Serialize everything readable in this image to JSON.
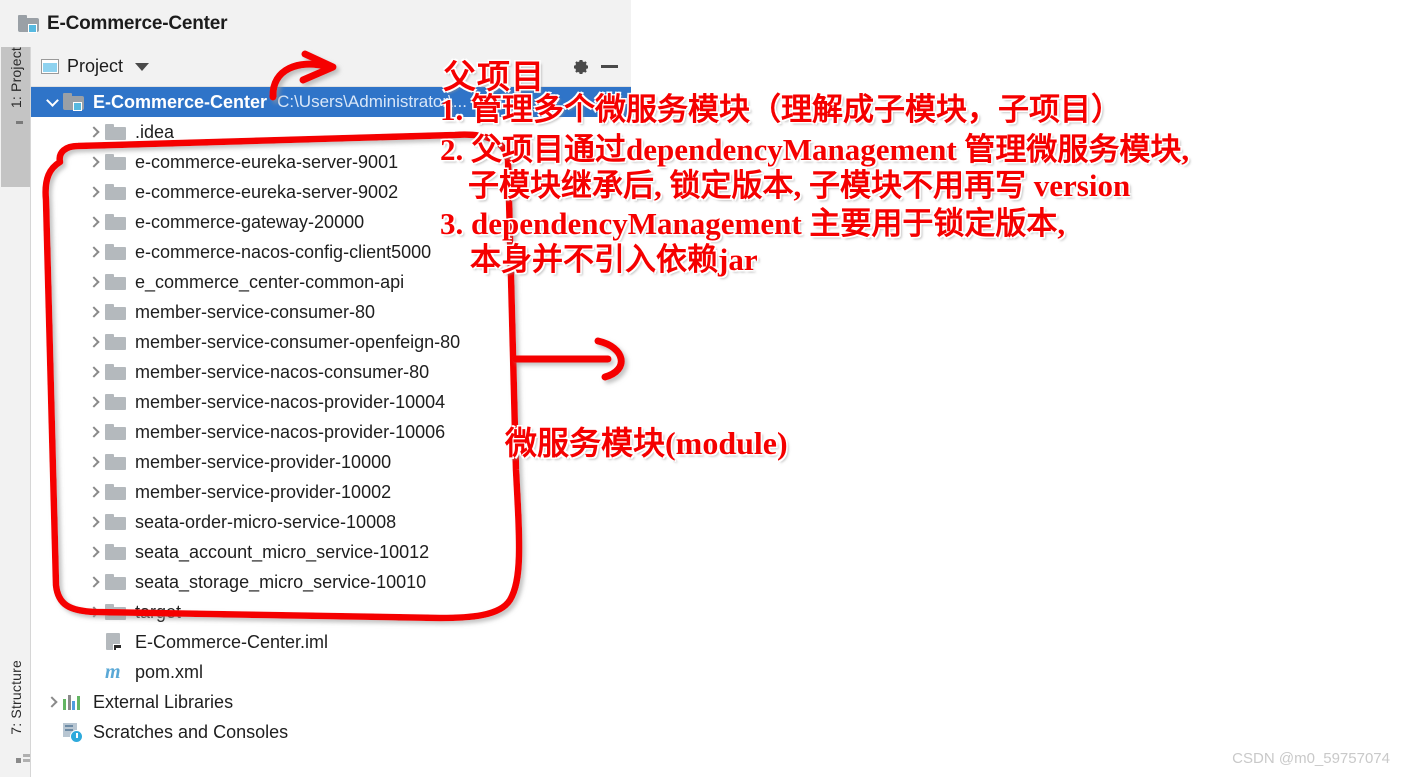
{
  "window": {
    "title": "E-Commerce-Center",
    "title_icon": "project-folder-icon"
  },
  "toolstrip": {
    "tabs": [
      {
        "label": "1: Project",
        "icon": "folder-icon",
        "active": true
      },
      {
        "label": "7: Structure",
        "icon": "structure-icon",
        "active": false
      }
    ]
  },
  "tool_window": {
    "title": "Project",
    "dropdown_icon": "chevron-down-icon",
    "view_icon": "project-view-icon",
    "settings_icon": "gear-icon",
    "hide_icon": "minimize-icon"
  },
  "tree": [
    {
      "label": "E-Commerce-Center",
      "path": "C:\\Users\\Administrator\\...",
      "icon": "project-folder-icon",
      "expanded": true,
      "selected": true,
      "depth": 0,
      "bold": true
    },
    {
      "label": ".idea",
      "icon": "folder-icon",
      "expandable": true,
      "depth": 1
    },
    {
      "label": "e-commerce-eureka-server-9001",
      "icon": "folder-icon",
      "expandable": true,
      "depth": 1
    },
    {
      "label": "e-commerce-eureka-server-9002",
      "icon": "folder-icon",
      "expandable": true,
      "depth": 1
    },
    {
      "label": "e-commerce-gateway-20000",
      "icon": "folder-icon",
      "expandable": true,
      "depth": 1
    },
    {
      "label": "e-commerce-nacos-config-client5000",
      "icon": "folder-icon",
      "expandable": true,
      "depth": 1
    },
    {
      "label": "e_commerce_center-common-api",
      "icon": "folder-icon",
      "expandable": true,
      "depth": 1
    },
    {
      "label": "member-service-consumer-80",
      "icon": "folder-icon",
      "expandable": true,
      "depth": 1
    },
    {
      "label": "member-service-consumer-openfeign-80",
      "icon": "folder-icon",
      "expandable": true,
      "depth": 1
    },
    {
      "label": "member-service-nacos-consumer-80",
      "icon": "folder-icon",
      "expandable": true,
      "depth": 1
    },
    {
      "label": "member-service-nacos-provider-10004",
      "icon": "folder-icon",
      "expandable": true,
      "depth": 1
    },
    {
      "label": "member-service-nacos-provider-10006",
      "icon": "folder-icon",
      "expandable": true,
      "depth": 1
    },
    {
      "label": "member-service-provider-10000",
      "icon": "folder-icon",
      "expandable": true,
      "depth": 1
    },
    {
      "label": "member-service-provider-10002",
      "icon": "folder-icon",
      "expandable": true,
      "depth": 1
    },
    {
      "label": "seata-order-micro-service-10008",
      "icon": "folder-icon",
      "expandable": true,
      "depth": 1
    },
    {
      "label": "seata_account_micro_service-10012",
      "icon": "folder-icon",
      "expandable": true,
      "depth": 1
    },
    {
      "label": "seata_storage_micro_service-10010",
      "icon": "folder-icon",
      "expandable": true,
      "depth": 1
    },
    {
      "label": "target",
      "icon": "folder-icon",
      "expandable": true,
      "depth": 1
    },
    {
      "label": "E-Commerce-Center.iml",
      "icon": "iml-file-icon",
      "expandable": false,
      "depth": 1
    },
    {
      "label": "pom.xml",
      "icon": "maven-file-icon",
      "expandable": false,
      "depth": 1
    },
    {
      "label": "External Libraries",
      "icon": "libraries-icon",
      "expandable": true,
      "depth": 0
    },
    {
      "label": "Scratches and Consoles",
      "icon": "scratches-icon",
      "expandable": false,
      "depth": 0
    }
  ],
  "annotations": {
    "parent_project": "父项目",
    "line1": "1. 管理多个微服务模块（理解成子模块，子项目）",
    "line2": "2. 父项目通过dependencyManagement 管理微服务模块,",
    "line3": "子模块继承后, 锁定版本, 子模块不用再写 version",
    "line4": "3. dependencyManagement 主要用于锁定版本,",
    "line5": "本身并不引入依赖jar",
    "module_label": "微服务模块(module)",
    "color": "#f50000"
  },
  "watermark": "CSDN @m0_59757074",
  "colors": {
    "selection_blue": "#2f74c8",
    "panel_grey": "#f2f2f2",
    "annotation_red": "#f50000",
    "folder_grey": "#b4b9bd"
  }
}
